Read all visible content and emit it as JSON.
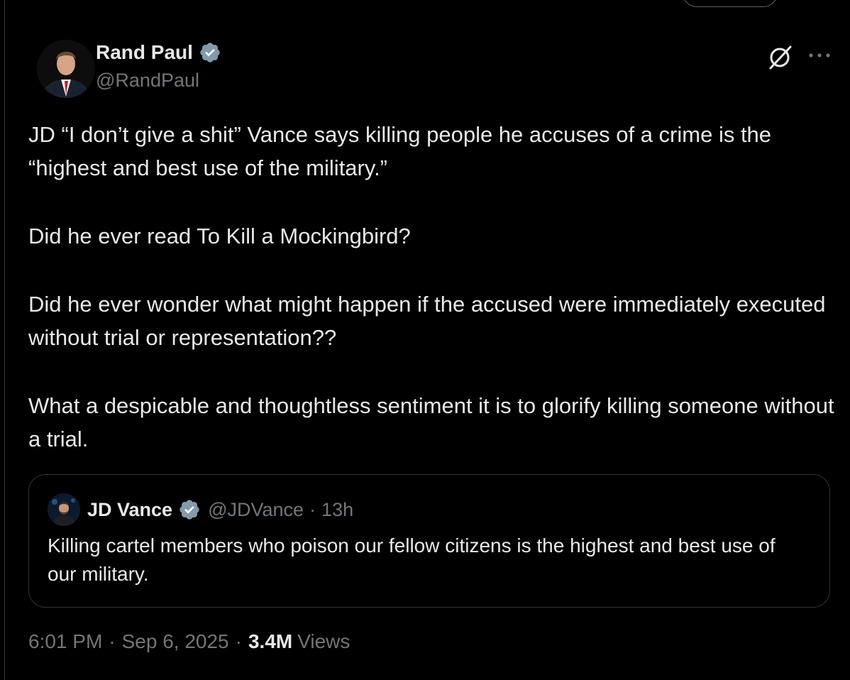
{
  "colors": {
    "background": "#000000",
    "text_primary": "#e7e9ea",
    "text_secondary": "#71767b",
    "border": "#2f3336",
    "verified_badge": "#829aab"
  },
  "tweet": {
    "author": {
      "name": "Rand Paul",
      "handle": "@RandPaul",
      "verified": true,
      "avatar_icon": "profile-photo"
    },
    "header_icons": [
      "grok-icon",
      "more-options-icon"
    ],
    "paragraphs": [
      "JD “I don’t give a shit” Vance says killing people he accuses of a crime is the “highest and best use of the military.”",
      "Did he ever read To Kill a Mockingbird?",
      "Did he ever wonder what might happen if the accused were immediately executed without trial or representation??",
      "What a despicable and thoughtless sentiment it is to glorify killing someone without a trial."
    ],
    "quoted": {
      "name": "JD Vance",
      "handle": "@JDVance",
      "separator": "·",
      "time": "13h",
      "verified": true,
      "text": "Killing cartel members who poison our fellow citizens is the highest and best use of our military."
    },
    "meta": {
      "time": "6:01 PM",
      "separator": "·",
      "date": "Sep 6, 2025",
      "views_count": "3.4M",
      "views_label": "Views"
    }
  }
}
